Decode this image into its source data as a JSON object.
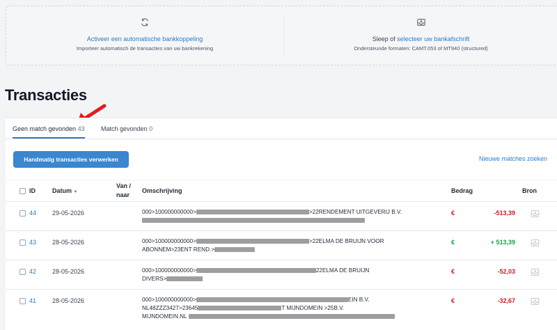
{
  "import": {
    "auto": {
      "title": "Activeer een automatische bankkoppeling",
      "subtitle": "Importeer automatisch de transacties van uw bankrekening"
    },
    "upload": {
      "title_prefix": "Sleep of ",
      "title_link": "selecteer uw bankafschrift",
      "subtitle": "Ondersteunde formaten: CAMT.053 of MT940 (structured)"
    }
  },
  "page_title": "Transacties",
  "tabs": [
    {
      "label": "Geen match gevonden",
      "count": "43"
    },
    {
      "label": "Match gevonden",
      "count": "0"
    }
  ],
  "actions": {
    "manual_button": "Handmatig transacties verwerken",
    "find_matches": "Nieuwe matches zoeken"
  },
  "table": {
    "headers": {
      "id": "ID",
      "date": "Datum",
      "vannaar_1": "Van /",
      "vannaar_2": "naar",
      "description": "Omschrijving",
      "amount": "Bedrag",
      "source": "Bron"
    },
    "rows": [
      {
        "id": "44",
        "date": "29-05-2026",
        "desc_line1_prefix": "000>100000000000>",
        "desc_line1_suffix": ">22RENDEMENT UITGEVERIJ B.V.",
        "desc_line2": "",
        "euro": "€",
        "amount": "-513,39",
        "sign": "neg"
      },
      {
        "id": "43",
        "date": "28-05-2026",
        "desc_line1_prefix": "000>100000000000>",
        "desc_line1_suffix": ">22ELMA DE BRUIJN VOOR",
        "desc_line2": "ABONNEM>23ENT REND.>",
        "euro": "€",
        "amount": "+ 513,39",
        "sign": "pos"
      },
      {
        "id": "42",
        "date": "28-05-2026",
        "desc_line1_prefix": "000>100000000000>",
        "desc_line1_suffix": "22ELMA DE BRUIJN",
        "desc_line2": "DIVERS>",
        "euro": "€",
        "amount": "-52,03",
        "sign": "neg"
      },
      {
        "id": "41",
        "date": "28-05-2026",
        "desc_line1_prefix": "000>100000000000>",
        "desc_line1_suffix": "EIN B.V.",
        "desc_line2": "NL48ZZZ3427>23645",
        "desc_line2_mid": "T MIJNDOMEIN >25B.V.",
        "desc_line3": "MIJNDOMEIN.NL",
        "euro": "€",
        "amount": "-32,67",
        "sign": "neg"
      }
    ]
  },
  "colors": {
    "accent": "#2b7bc4",
    "button": "#3a86cf",
    "negative": "#c81e1e",
    "positive": "#16a34a",
    "annotation_arrow": "#e11d1d"
  }
}
